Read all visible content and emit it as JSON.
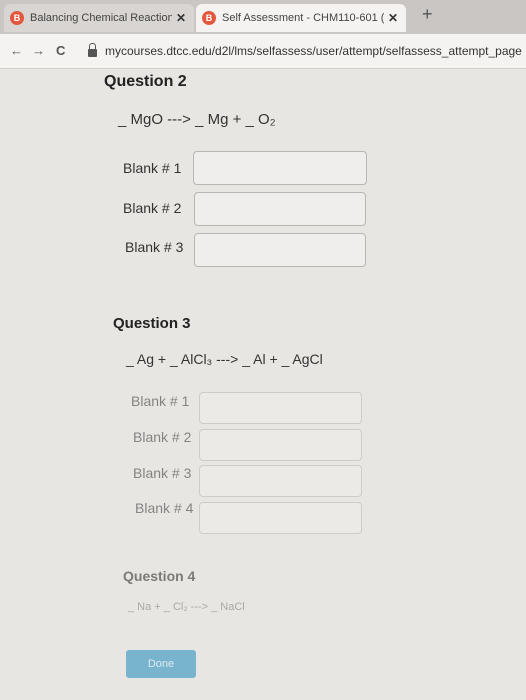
{
  "browser": {
    "tabs": [
      {
        "title": "Balancing Chemical Reactions · C",
        "close": "✕",
        "favicon": "B"
      },
      {
        "title": "Self Assessment - CHM110-601 (",
        "close": "✕",
        "favicon": "B"
      }
    ],
    "new_tab": "+",
    "back": "←",
    "forward": "→",
    "reload": "C",
    "url": "mycourses.dtcc.edu/d2l/lms/selfassess/user/attempt/selfassess_attempt_page"
  },
  "question2": {
    "title": "Question 2",
    "equation": "_ MgO ---> _ Mg + _ O₂",
    "blanks": [
      "Blank # 1",
      "Blank # 2",
      "Blank # 3"
    ]
  },
  "question3": {
    "title": "Question 3",
    "equation": "_ Ag + _ AlCl₃ ---> _ Al + _ AgCl",
    "blanks": [
      "Blank # 1",
      "Blank # 2",
      "Blank # 3",
      "Blank # 4"
    ]
  },
  "question4": {
    "title": "Question 4",
    "equation": "_ Na + _ Cl₂ ---> _ NaCl"
  },
  "done_label": "Done"
}
